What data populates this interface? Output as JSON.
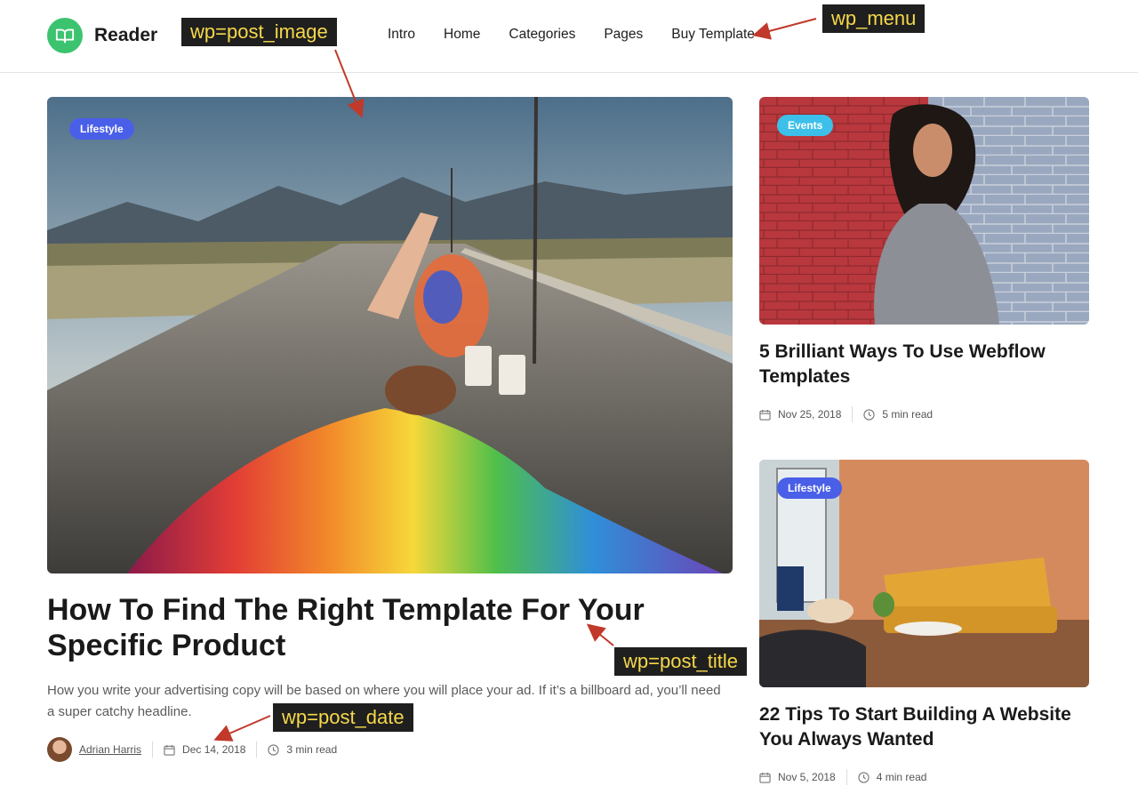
{
  "app": {
    "name": "Reader"
  },
  "nav": {
    "items": [
      "Intro",
      "Home",
      "Categories",
      "Pages",
      "Buy Template"
    ]
  },
  "annotations": {
    "post_image": "wp=post_image",
    "menu": "wp_menu",
    "post_title": "wp=post_title",
    "post_date": "wp=post_date",
    "color": "#c0392b"
  },
  "featured": {
    "category": "Lifestyle",
    "title": "How To Find The Right Template For Your Specific Product",
    "excerpt": "How you write your advertising copy will be based on where you will place your ad. If it’s a billboard ad, you’ll need a super catchy headline.",
    "author": "Adrian Harris",
    "date": "Dec 14, 2018",
    "read_time": "3 min read"
  },
  "side_posts": [
    {
      "category": "Events",
      "title": "5 Brilliant Ways To Use Webflow Templates",
      "date": "Nov 25, 2018",
      "read_time": "5 min read"
    },
    {
      "category": "Lifestyle",
      "title": "22 Tips To Start Building A Website You Always Wanted",
      "date": "Nov 5, 2018",
      "read_time": "4 min read"
    }
  ],
  "colors": {
    "brand": "#3cc36f",
    "badge_blue": "#4a5fe8",
    "badge_cyan": "#3cc0ea"
  }
}
